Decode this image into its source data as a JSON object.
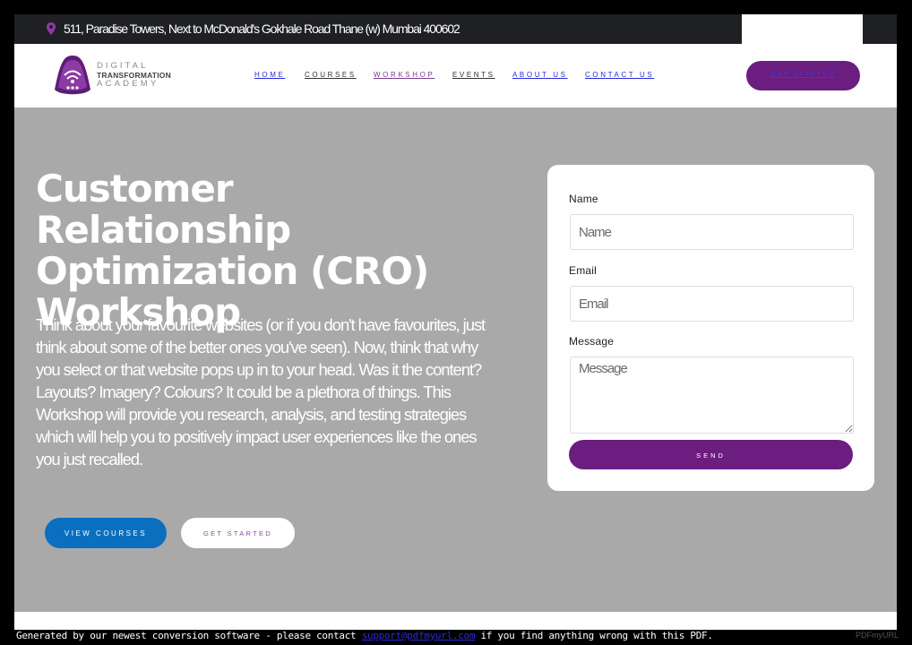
{
  "topbar": {
    "address": "511, Paradise Towers, Next to McDonald's Gokhale Road Thane (w) Mumbai 400602",
    "social_links": [
      "",
      "",
      "",
      "",
      ""
    ]
  },
  "logo": {
    "line1": "DIGITAL",
    "line2": "TRANSFORMATION",
    "line3": "ACADEMY"
  },
  "nav": {
    "items": [
      {
        "label": "HOME"
      },
      {
        "label": "COURSES"
      },
      {
        "label": "WORKSHOP"
      },
      {
        "label": "EVENTS"
      },
      {
        "label": "ABOUT US"
      },
      {
        "label": "CONTACT US"
      }
    ],
    "cta": "GET STARTED"
  },
  "hero": {
    "title": "Customer Relationship Optimization (CRO) Workshop",
    "description": "Think about your favourite websites (or if you don't have favourites, just think about some of the better ones you've seen). Now, think that why you select or that website pops up in to your head.  Was it the content? Layouts? Imagery? Colours? It could be a plethora of things. This Workshop will provide you research, analysis, and testing strategies which will help you to positively impact user experiences like the ones you just recalled.",
    "btn_courses": "VIEW COURSES",
    "btn_started": "GET STARTED"
  },
  "form": {
    "name_label": "Name",
    "name_placeholder": "Name",
    "email_label": "Email",
    "email_placeholder": "Email",
    "message_label": "Message",
    "message_placeholder": "Message",
    "send_label": "SEND"
  },
  "footer": {
    "before": "Generated by our newest conversion software - please contact ",
    "link": "support@pdfmyurl.com",
    "after": " if you find anything wrong with this PDF.",
    "pdf_logo": "PDFmyURL"
  },
  "colors": {
    "brand_purple": "#6b1d80",
    "brand_blue": "#0b6fc0",
    "hero_gray": "#a9a9a9"
  }
}
